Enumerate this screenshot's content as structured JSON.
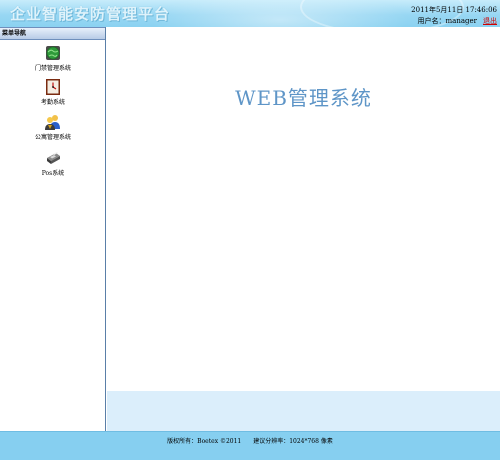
{
  "header": {
    "title": "企业智能安防管理平台",
    "datetime": "2011年5月11日 17:46:06",
    "user_label": "用户名：manager",
    "logout_label": "退出"
  },
  "sidebar": {
    "title": "菜单导航",
    "items": [
      {
        "label": "门禁管理系统",
        "icon": "globe-door-icon"
      },
      {
        "label": "考勤系统",
        "icon": "clock-icon"
      },
      {
        "label": "公寓管理系统",
        "icon": "people-icon"
      },
      {
        "label": "Pos系统",
        "icon": "pos-machine-icon"
      }
    ]
  },
  "main": {
    "title": "WEB管理系统"
  },
  "footer": {
    "copyright": "版权所有：Boetex ©2011",
    "resolution": "建议分辨率：1024*768 像素"
  },
  "colors": {
    "header_bg": "#98d7f3",
    "footer_bg": "#86cff0",
    "main_title": "#5e95c7",
    "logout_link": "#d00000",
    "content_bottom": "#dbeefb"
  }
}
